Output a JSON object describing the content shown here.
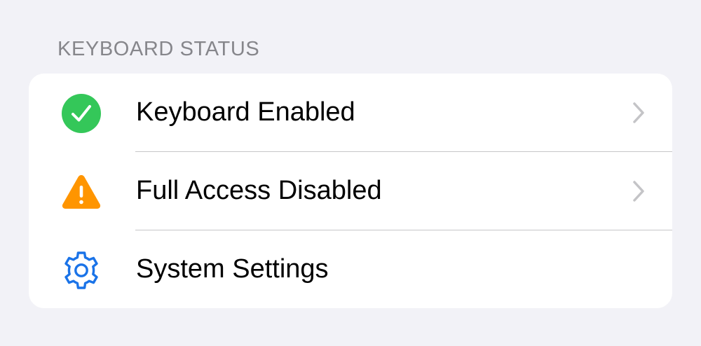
{
  "section": {
    "header": "KEYBOARD STATUS"
  },
  "rows": [
    {
      "label": "Keyboard Enabled",
      "icon": "checkmark-circle-icon",
      "icon_color": "#34c759",
      "has_chevron": true
    },
    {
      "label": "Full Access Disabled",
      "icon": "warning-triangle-icon",
      "icon_color": "#ff9500",
      "has_chevron": true
    },
    {
      "label": "System Settings",
      "icon": "gear-icon",
      "icon_color": "#1a73e8",
      "has_chevron": false
    }
  ],
  "colors": {
    "background": "#f2f2f7",
    "card": "#ffffff",
    "chevron": "#c4c4c7",
    "separator": "#c6c6c8",
    "header_text": "#86868b"
  }
}
